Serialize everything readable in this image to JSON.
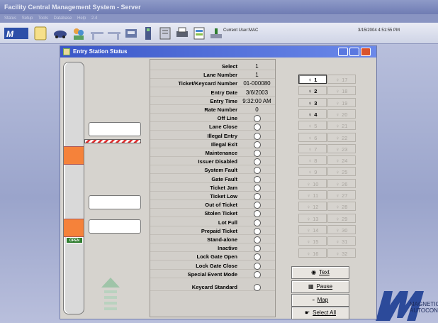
{
  "app": {
    "title": "Facility Central Management System - Server",
    "menu": [
      "Status",
      "Setup",
      "Tools",
      "Database",
      "Help",
      "2.4"
    ],
    "current_user": "Current User:MAC",
    "datetime": "3/15/2004 4:51:55 PM"
  },
  "window": {
    "title": "Entry Station Status"
  },
  "gate": {
    "open_label": "OPEN"
  },
  "status_rows": [
    {
      "label": "Select",
      "value": "1"
    },
    {
      "label": "Lane Number",
      "value": "1"
    },
    {
      "label": "Ticket/Keycard Number",
      "value": "01-000080"
    },
    {
      "label": "Entry Date",
      "value": "3/6/2003"
    },
    {
      "label": "Entry Time",
      "value": "9:32:00 AM"
    },
    {
      "label": "Rate Number",
      "value": "0"
    },
    {
      "label": "Off Line"
    },
    {
      "label": "Lane Close"
    },
    {
      "label": "Illegal Entry"
    },
    {
      "label": "Illegal Exit"
    },
    {
      "label": "Maintenance"
    },
    {
      "label": "Issuer Disabled"
    },
    {
      "label": "System Fault"
    },
    {
      "label": "Gate Fault"
    },
    {
      "label": "Ticket Jam"
    },
    {
      "label": "Ticket Low"
    },
    {
      "label": "Out of Ticket"
    },
    {
      "label": "Stolen Ticket"
    },
    {
      "label": "Lot Full"
    },
    {
      "label": "Prepaid Ticket"
    },
    {
      "label": "Stand-alone"
    },
    {
      "label": "Inactive"
    },
    {
      "label": "Lock Gate Open"
    },
    {
      "label": "Lock Gate Close"
    },
    {
      "label": "Special Event Mode"
    },
    {
      "label": "Keycard Standard"
    }
  ],
  "lanes": {
    "left": [
      "1",
      "2",
      "3",
      "4",
      "5",
      "6",
      "7",
      "8",
      "9",
      "10",
      "11",
      "12",
      "13",
      "14",
      "15",
      "16"
    ],
    "right": [
      "17",
      "18",
      "19",
      "20",
      "21",
      "22",
      "23",
      "24",
      "25",
      "26",
      "27",
      "28",
      "29",
      "30",
      "31",
      "32"
    ],
    "active": [
      "1",
      "2",
      "3",
      "4"
    ],
    "selected": "1"
  },
  "buttons": {
    "text": "Text",
    "pause": "Pause",
    "map": "Map",
    "select_all": "Select All"
  },
  "logo": {
    "text": "MAGNETIC\nAUTOCONTRO"
  },
  "colors": {
    "gate_orange": "#f5823a",
    "title_blue": "#3b57c8",
    "open_green": "#2f7d2f"
  }
}
